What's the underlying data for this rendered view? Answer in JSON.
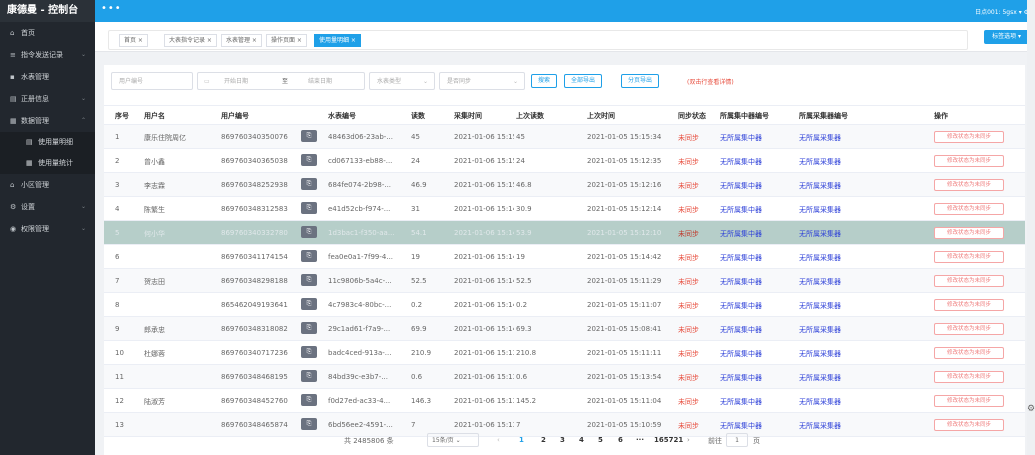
{
  "app": {
    "title": "康德曼 - 控制台",
    "user_label": "日点001: 5gsx ▾  ⚙"
  },
  "sidebar": {
    "items": [
      {
        "label": "首页",
        "icon": "home-icon",
        "glyph": "⌂",
        "arrow": ""
      },
      {
        "label": "指令发送记录",
        "icon": "command-icon",
        "glyph": "≡",
        "arrow": "⌄"
      },
      {
        "label": "水表管理",
        "icon": "meter-icon",
        "glyph": "▪",
        "arrow": ""
      },
      {
        "label": "正册信息",
        "icon": "info-icon",
        "glyph": "▤",
        "arrow": "⌄"
      },
      {
        "label": "数据管理",
        "icon": "data-icon",
        "glyph": "▦",
        "arrow": "⌃"
      }
    ],
    "sub_items": [
      {
        "label": "使用量明细",
        "icon": "detail-icon",
        "glyph": "▤"
      },
      {
        "label": "使用量统计",
        "icon": "stats-icon",
        "glyph": "▦"
      }
    ],
    "items2": [
      {
        "label": "小区管理",
        "icon": "community-icon",
        "glyph": "⌂",
        "arrow": ""
      },
      {
        "label": "设置",
        "icon": "settings-icon",
        "glyph": "⚙",
        "arrow": "⌄"
      },
      {
        "label": "权限管理",
        "icon": "permission-icon",
        "glyph": "◉",
        "arrow": "⌄"
      }
    ]
  },
  "tabs": {
    "items": [
      "首页 ×",
      "大表指令记录 ×",
      "水表管理 ×",
      "操作页面 ×",
      "使用量明细 ×"
    ],
    "ops": "标签选项 ▾"
  },
  "filter": {
    "user_no": "用户编号",
    "start": "开始日期",
    "to": "至",
    "end": "结束日期",
    "meter_type": "水表类型",
    "sync": "是否同步",
    "search": "搜索",
    "export_all": "全部导出",
    "export_page": "分页导出",
    "hint": "(双击行查看详情)"
  },
  "table": {
    "headers": [
      "序号",
      "用户名",
      "用户编号",
      "水表编号",
      "读数",
      "采集时间",
      "上次读数",
      "上次时间",
      "同步状态",
      "所属集中器编号",
      "所属采集器编号",
      "操作"
    ],
    "rows": [
      {
        "no": "1",
        "name": "康乐住院周亿",
        "uid": "869760340350076",
        "meter": "48463d06-23ab-...",
        "read": "45",
        "time": "2021-01-06 15:15:28",
        "last": "45",
        "lastTime": "2021-01-05 15:15:34",
        "sync": "未同步",
        "conc": "无所属集中器",
        "coll": "无所属采集器",
        "op": "修改状态为未同步"
      },
      {
        "no": "2",
        "name": "曾小鑫",
        "uid": "869760340365038",
        "meter": "cd067133-eb88-...",
        "read": "24",
        "time": "2021-01-06 15:15:23",
        "last": "24",
        "lastTime": "2021-01-05 15:12:35",
        "sync": "未同步",
        "conc": "无所属集中器",
        "coll": "无所属采集器",
        "op": "修改状态为未同步"
      },
      {
        "no": "3",
        "name": "李志霖",
        "uid": "869760348252938",
        "meter": "684fe074-2b98-...",
        "read": "46.9",
        "time": "2021-01-06 15:15:09",
        "last": "46.8",
        "lastTime": "2021-01-05 15:12:16",
        "sync": "未同步",
        "conc": "无所属集中器",
        "coll": "无所属采集器",
        "op": "修改状态为未同步"
      },
      {
        "no": "4",
        "name": "陈繁生",
        "uid": "869760348312583",
        "meter": "e41d52cb-f974-...",
        "read": "31",
        "time": "2021-01-06 15:14:58",
        "last": "30.9",
        "lastTime": "2021-01-05 15:12:14",
        "sync": "未同步",
        "conc": "无所属集中器",
        "coll": "无所属采集器",
        "op": "修改状态为未同步"
      },
      {
        "no": "5",
        "name": "何小华",
        "uid": "869760340332780",
        "meter": "1d3bac1-f350-aa...",
        "read": "54.1",
        "time": "2021-01-06 15:14:49",
        "last": "53.9",
        "lastTime": "2021-01-05 15:12:10",
        "sync": "未同步",
        "conc": "无所属集中器",
        "coll": "无所属采集器",
        "op": "修改状态为未同步"
      },
      {
        "no": "6",
        "name": "",
        "uid": "869760341174154",
        "meter": "fea0e0a1-7f99-4...",
        "read": "19",
        "time": "2021-01-06 15:14:32",
        "last": "19",
        "lastTime": "2021-01-05 15:14:42",
        "sync": "未同步",
        "conc": "无所属集中器",
        "coll": "无所属采集器",
        "op": "修改状态为未同步"
      },
      {
        "no": "7",
        "name": "贺志田",
        "uid": "869760348298188",
        "meter": "11c9806b-5a4c-...",
        "read": "52.5",
        "time": "2021-01-06 15:14:12",
        "last": "52.5",
        "lastTime": "2021-01-05 15:11:29",
        "sync": "未同步",
        "conc": "无所属集中器",
        "coll": "无所属采集器",
        "op": "修改状态为未同步"
      },
      {
        "no": "8",
        "name": "",
        "uid": "865462049193641",
        "meter": "4c7983c4-80bc-...",
        "read": "0.2",
        "time": "2021-01-06 15:14:06",
        "last": "0.2",
        "lastTime": "2021-01-05 15:11:07",
        "sync": "未同步",
        "conc": "无所属集中器",
        "coll": "无所属采集器",
        "op": "修改状态为未同步"
      },
      {
        "no": "9",
        "name": "郎承忠",
        "uid": "869760348318082",
        "meter": "29c1ad61-f7a9-...",
        "read": "69.9",
        "time": "2021-01-06 15:14:04",
        "last": "69.3",
        "lastTime": "2021-01-05 15:08:41",
        "sync": "未同步",
        "conc": "无所属集中器",
        "coll": "无所属采集器",
        "op": "修改状态为未同步"
      },
      {
        "no": "10",
        "name": "杜娜蓉",
        "uid": "869760340717236",
        "meter": "badc4ced-913a-...",
        "read": "210.9",
        "time": "2021-01-06 15:13:54",
        "last": "210.8",
        "lastTime": "2021-01-05 15:11:11",
        "sync": "未同步",
        "conc": "无所属集中器",
        "coll": "无所属采集器",
        "op": "修改状态为未同步"
      },
      {
        "no": "11",
        "name": "",
        "uid": "869760348468195",
        "meter": "84bd39c-e3b7-...",
        "read": "0.6",
        "time": "2021-01-06 15:13:51",
        "last": "0.6",
        "lastTime": "2021-01-05 15:13:54",
        "sync": "未同步",
        "conc": "无所属集中器",
        "coll": "无所属采集器",
        "op": "修改状态为未同步"
      },
      {
        "no": "12",
        "name": "陆淑芳",
        "uid": "869760348452760",
        "meter": "f0d27ed-ac33-4...",
        "read": "146.3",
        "time": "2021-01-06 15:13:48",
        "last": "145.2",
        "lastTime": "2021-01-05 15:11:04",
        "sync": "未同步",
        "conc": "无所属集中器",
        "coll": "无所属采集器",
        "op": "修改状态为未同步"
      },
      {
        "no": "13",
        "name": "",
        "uid": "869760348465874",
        "meter": "6bd56ee2-4591-...",
        "read": "7",
        "time": "2021-01-06 15:13:44",
        "last": "7",
        "lastTime": "2021-01-05 15:10:59",
        "sync": "未同步",
        "conc": "无所属集中器",
        "coll": "无所属采集器",
        "op": "修改状态为未同步"
      }
    ],
    "copy_glyph": "⎘"
  },
  "pagination": {
    "total": "共 2485806 条",
    "per_page": "15条/页 ⌄",
    "prev": "‹",
    "pages": [
      "1",
      "2",
      "3",
      "4",
      "5",
      "6",
      "···",
      "165721"
    ],
    "next": "›",
    "goto": "前往",
    "goto_value": "1",
    "page_unit": "页"
  },
  "colors": {
    "accent": "#1fa0e8",
    "sidebar": "#22272e",
    "danger": "#e74c3c",
    "link": "#2c3fd8"
  }
}
